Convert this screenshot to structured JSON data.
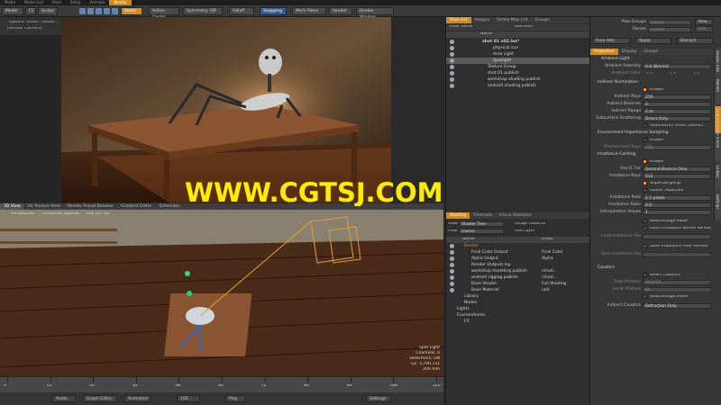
{
  "menubar": {
    "items": [
      "Model",
      "Model (Lu)",
      "Paint",
      "Setup",
      "Animate",
      "Render"
    ],
    "active_index": 5
  },
  "toolbar": {
    "model_label": "Model",
    "f2_label": "F2",
    "sculpt_label": "Sculpt",
    "items_label": "Items",
    "action_center_label": "Action Center",
    "symmetry_label": "Symmetry: Off",
    "falloff_label": "Falloff",
    "snapping_label": "Snapping",
    "work_plane_label": "Work Plane",
    "render_label": "Render",
    "render_window_label": "Render Window"
  },
  "info_strip": {
    "options": "Options",
    "effect": "Effect: (Shadi...",
    "paused": "Paused",
    "lut": "LUT: sRGB",
    "render_camera": "(Render Camera)",
    "ic_update": "IC Update"
  },
  "item_list": {
    "tabs": [
      "Item List",
      "Images",
      "Vertex Map List",
      "Groups"
    ],
    "active_tab": 0,
    "filter_label": "Filter Items",
    "add_item_label": "Add Item",
    "column_name": "Name",
    "rows": [
      {
        "label": "shot 01 v02.lxo*",
        "indent": 0,
        "bold": true
      },
      {
        "label": "physical sun",
        "indent": 2
      },
      {
        "label": "Area Light",
        "indent": 2
      },
      {
        "label": "Spotlight",
        "indent": 2,
        "selected": true
      },
      {
        "label": "Texture Group",
        "indent": 1
      },
      {
        "label": "shot 01 publish",
        "indent": 1
      },
      {
        "label": "workshop shading publish",
        "indent": 1
      },
      {
        "label": "android shading publish",
        "indent": 1
      }
    ]
  },
  "shading": {
    "tabs": [
      "Shading",
      "Channels",
      "Info & Statistics"
    ],
    "active_tab": 0,
    "view_label": "View",
    "view_value": "Shader Tree",
    "assign_material": "Assign Material",
    "filter_label": "Filter",
    "filter_value": "(none)",
    "add_layer": "Add Layer",
    "col_name": "Name",
    "col_effect": "Effect",
    "rows": [
      {
        "name": "Render",
        "effect": "",
        "indent": 1,
        "orange": true
      },
      {
        "name": "Final Color Output",
        "effect": "Final Color",
        "indent": 2
      },
      {
        "name": "Alpha Output",
        "effect": "Alpha",
        "indent": 2
      },
      {
        "name": "Render Outputs.lxp",
        "effect": "",
        "indent": 2
      },
      {
        "name": "workshop modeling publish",
        "effect": "(shad...",
        "indent": 2
      },
      {
        "name": "android rigging publish",
        "effect": "(shad...",
        "indent": 2
      },
      {
        "name": "Base Shader",
        "effect": "Full Shading",
        "indent": 2
      },
      {
        "name": "Base Material",
        "effect": "(all)",
        "indent": 2
      },
      {
        "name": "Library",
        "effect": "",
        "indent": 1
      },
      {
        "name": "Nodes",
        "effect": "",
        "indent": 1
      },
      {
        "name": "Lights",
        "effect": "",
        "indent": 0
      },
      {
        "name": "Environments",
        "effect": "",
        "indent": 0
      },
      {
        "name": "FX",
        "effect": "",
        "indent": 1
      }
    ]
  },
  "properties": {
    "pass_groups_label": "Pass Groups",
    "pass_groups_value": "(none)",
    "passes_label": "Passes",
    "passes_value": "(none)",
    "new_label": "New",
    "edit_label": "Edit",
    "auto_add": "Auto Add",
    "apply": "Apply",
    "discard": "Discard",
    "tabs": [
      "Properties",
      "Display",
      "Groups"
    ],
    "active_tab": 0,
    "ambient_light": "Ambient Light",
    "ambient_intensity_label": "Ambient Intensity",
    "ambient_intensity_value": "0.0 W/srm2",
    "ambient_color_label": "Ambient Color",
    "ambient_color_values": [
      "1.0",
      "1.0",
      "1.0"
    ],
    "indirect_illum": "Indirect Illumination",
    "enable_label": "Enable",
    "indirect_rays_label": "Indirect Rays",
    "indirect_rays_value": "256",
    "indirect_bounces_label": "Indirect Bounces",
    "indirect_bounces_value": "2",
    "indirect_range_label": "Indirect Range",
    "indirect_range_value": "2 m",
    "subsurface_label": "Subsurface Scattering",
    "subsurface_value": "Direct Only",
    "volumetrics_label": "Volumetrics Affect Indirect",
    "env_importance": "Environment Importance Sampling",
    "env_rays_label": "Environment Rays",
    "env_rays_value": "256",
    "irradiance_caching": "Irradiance Caching",
    "use_ic_for_label": "Use IC For",
    "use_ic_for_value": "Second Bounce Only",
    "irr_rays_label": "Irradiance Rays",
    "irr_rays_value": "512",
    "supersampling_label": "Supersampling",
    "outlier_label": "Outlier Rejection",
    "irr_rate_label": "Irradiance Rate",
    "irr_rate_value": "2.5 pixels",
    "irr_ratio_label": "Irradiance Ratio",
    "irr_ratio_value": "6.0",
    "interp_label": "Interpolation Values",
    "interp_value": "1",
    "walkthrough_label": "Walkthrough Mode",
    "load_before_label": "Load Irradiance Before Render",
    "load_file_label": "Load Irradiance File",
    "save_after_label": "Save Irradiance After Render",
    "save_file_label": "Save Irradiance File",
    "caustics": "Caustics",
    "direct_caustics_label": "Direct Caustics",
    "total_photons_label": "Total Photons",
    "total_photons_value": "100000",
    "local_photons_label": "Local Photons",
    "local_photons_value": "64",
    "walkthrough2_label": "Walkthrough Mode",
    "indirect_caustics_label": "Indirect Caustics",
    "indirect_caustics_value": "Refraction Only",
    "vtabs": [
      "Shader Tree",
      "Render",
      "Global Illumination",
      "Frame",
      "Output",
      "Settings"
    ],
    "vtab_active": 2
  },
  "view3d": {
    "tabs": [
      "3D View",
      "UV Texture View",
      "Render Preset Browser",
      "Gradient Editor",
      "Schematic"
    ],
    "active_tab": 0,
    "perspective": "Perspective",
    "advanced": "Advanced OpenGL",
    "ray_gl": "Ray GL: Off",
    "stats": [
      "Spot Light",
      "Channels: 0",
      "Deformers: ON",
      "GL: 3,790,721",
      "200 mm"
    ]
  },
  "timeline": {
    "ticks": [
      "0",
      "12",
      "24",
      "36",
      "48",
      "60",
      "72",
      "84",
      "96",
      "108",
      "120"
    ],
    "end": "120"
  },
  "bottombar": {
    "audio": "Audio",
    "graph_editor": "Graph Editor",
    "animated": "Animated",
    "frame": "100",
    "play": "Play",
    "settings": "Settings"
  },
  "watermark": "WWW.CGTSJ.COM",
  "colors": {
    "accent_orange": "#d98c1a",
    "panel": "#2f2f2f",
    "watermark": "#ffeb00"
  }
}
